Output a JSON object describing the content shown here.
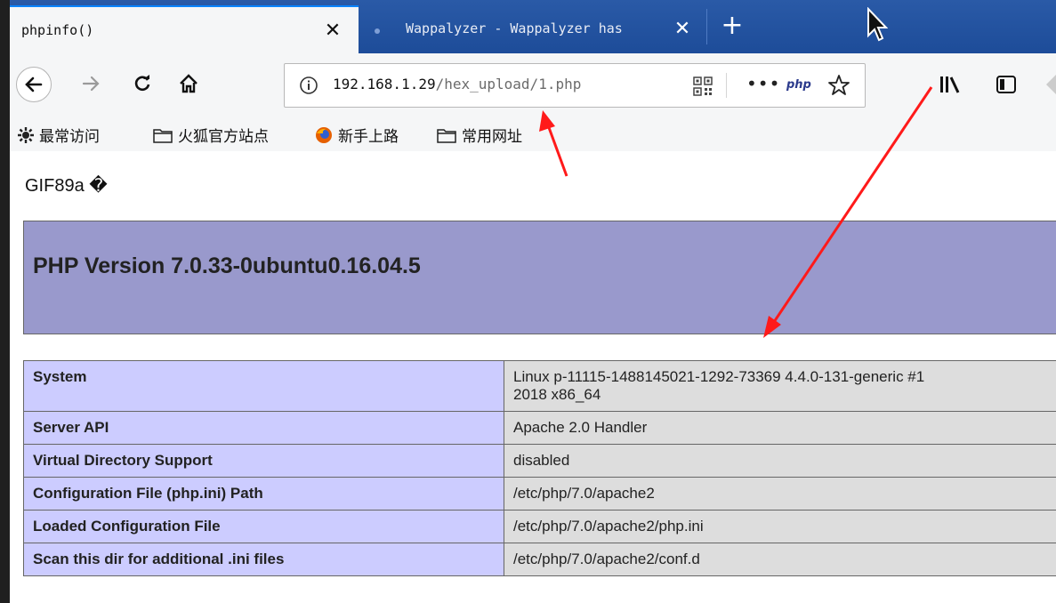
{
  "browser": {
    "tabs": [
      {
        "title": "phpinfo()",
        "active": true
      },
      {
        "title": "Wappalyzer - Wappalyzer has",
        "active": false
      }
    ],
    "url": {
      "host": "192.168.1.29",
      "path": "/hex_upload/1.php"
    },
    "url_php_badge": "php",
    "url_more": "•••"
  },
  "bookmarks": [
    {
      "label": "最常访问",
      "icon": "gear-icon"
    },
    {
      "label": "火狐官方站点",
      "icon": "folder-icon"
    },
    {
      "label": "新手上路",
      "icon": "firefox-icon"
    },
    {
      "label": "常用网址",
      "icon": "folder-icon"
    }
  ],
  "page": {
    "gif_header": "GIF89a �",
    "php_version_title": "PHP Version 7.0.33-0ubuntu0.16.04.5",
    "info_rows": [
      {
        "key": "System",
        "value": "Linux p-11115-1488145021-1292-73369 4.4.0-131-generic #1",
        "value2": "2018 x86_64"
      },
      {
        "key": "Server API",
        "value": "Apache 2.0 Handler"
      },
      {
        "key": "Virtual Directory Support",
        "value": "disabled"
      },
      {
        "key": "Configuration File (php.ini) Path",
        "value": "/etc/php/7.0/apache2"
      },
      {
        "key": "Loaded Configuration File",
        "value": "/etc/php/7.0/apache2/php.ini"
      },
      {
        "key": "Scan this dir for additional .ini files",
        "value": "/etc/php/7.0/apache2/conf.d"
      }
    ]
  },
  "colors": {
    "tab_strip": "#1d4c99",
    "php_header": "#9999cc",
    "key_cell": "#ccccff",
    "value_cell": "#dddddd",
    "annotation_arrow": "#ff1a1a"
  }
}
